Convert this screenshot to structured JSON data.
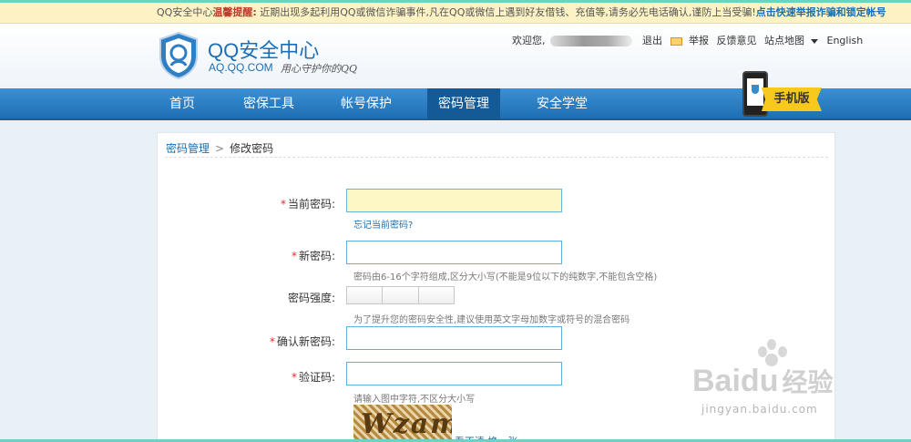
{
  "notice": {
    "prefix": "QQ安全中心",
    "warn": "温馨提醒:",
    "text": "近期出现多起利用QQ或微信诈骗事件,凡在QQ或微信上遇到好友借钱、充值等,请务必先电话确认,谨防上当受骗!",
    "link": "点击快速举报诈骗和锁定帐号"
  },
  "header": {
    "title": "QQ安全中心",
    "domain": "AQ.QQ.COM",
    "slogan": "用心守护你的QQ",
    "welcome": "欢迎您,",
    "logout": "退出",
    "report": "举报",
    "feedback": "反馈意见",
    "sitemap": "站点地图",
    "english": "English",
    "mobile_label": "手机版"
  },
  "nav": {
    "items": [
      "首页",
      "密保工具",
      "帐号保护",
      "密码管理",
      "安全学堂"
    ],
    "active_index": 3
  },
  "breadcrumb": {
    "parent": "密码管理",
    "separator": ">",
    "current": "修改密码"
  },
  "form": {
    "required_mark": "*",
    "current_pwd_label": "当前密码:",
    "forgot_link": "忘记当前密码?",
    "new_pwd_label": "新密码:",
    "new_pwd_hint": "密码由6-16个字符组成,区分大小写(不能是9位以下的纯数字,不能包含空格)",
    "strength_label": "密码强度:",
    "strength_hint": "为了提升您的密码安全性,建议使用英文字母加数字或符号的混合密码",
    "confirm_label": "确认新密码:",
    "captcha_label": "验证码:",
    "captcha_hint": "请输入图中字符,不区分大小写",
    "captcha_text": "Wzam",
    "refresh_link": "看不清,换一张"
  },
  "watermark": {
    "brand": "Bai",
    "brand_suffix": "du",
    "brand_cn": "经验",
    "url": "jingyan.baidu.com"
  }
}
